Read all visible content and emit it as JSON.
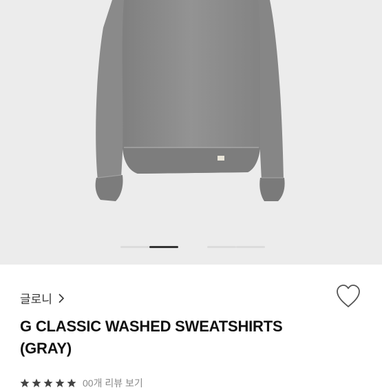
{
  "product": {
    "brand": "글로니",
    "title_line1": "G CLASSIC WASHED SWEATSHIRTS",
    "title_line2": "(GRAY)",
    "rating": 5,
    "review_text": "00개 리뷰 보기"
  },
  "gallery": {
    "image": "gray-sweatshirt",
    "slides": 5,
    "active_slide": 2
  },
  "colors": {
    "accent": "#333333",
    "garment": "#8c8c8c",
    "background": "#ececec"
  },
  "icons": {
    "wishlist": "heart-icon",
    "brand_link": "chevron-right-icon"
  }
}
